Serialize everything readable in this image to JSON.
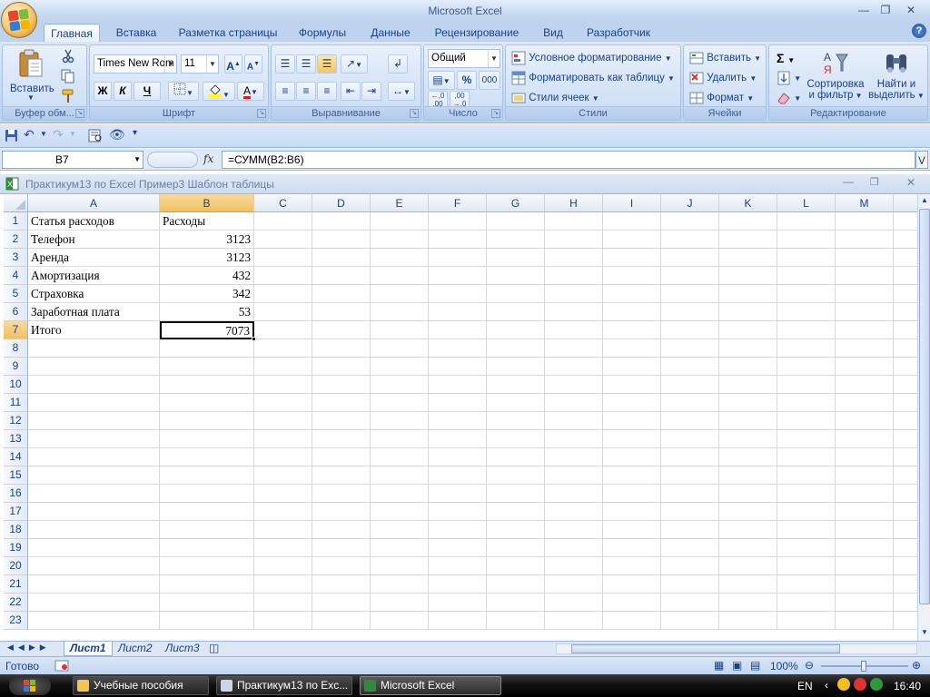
{
  "window": {
    "title": "Microsoft Excel"
  },
  "ribbon_tabs": [
    {
      "label": "Главная",
      "active": true
    },
    {
      "label": "Вставка"
    },
    {
      "label": "Разметка страницы"
    },
    {
      "label": "Формулы"
    },
    {
      "label": "Данные"
    },
    {
      "label": "Рецензирование"
    },
    {
      "label": "Вид"
    },
    {
      "label": "Разработчик"
    }
  ],
  "clipboard": {
    "label": "Буфер обм...",
    "paste_label": "Вставить"
  },
  "font": {
    "label": "Шрифт",
    "name": "Times New Rom",
    "size": "11",
    "bold": "Ж",
    "italic": "К",
    "underline": "Ч"
  },
  "alignment": {
    "label": "Выравнивание"
  },
  "number": {
    "label": "Число",
    "format": "Общий",
    "percent": "%",
    "thousands": "000"
  },
  "styles": {
    "label": "Стили",
    "conditional": "Условное форматирование",
    "format_table": "Форматировать как таблицу",
    "cell_styles": "Стили ячеек"
  },
  "cells": {
    "label": "Ячейки",
    "insert": "Вставить",
    "delete": "Удалить",
    "format": "Формат"
  },
  "editing": {
    "label": "Редактирование",
    "sum": "Σ",
    "sort_1": "Сортировка",
    "sort_2": "и фильтр",
    "find_1": "Найти и",
    "find_2": "выделить"
  },
  "formula_bar": {
    "name_box": "B7",
    "fx": "fx",
    "formula": "=СУММ(B2:B6)"
  },
  "workbook": {
    "title": "Практикум13 по Excel Пример3 Шаблон таблицы"
  },
  "columns": [
    "A",
    "B",
    "C",
    "D",
    "E",
    "F",
    "G",
    "H",
    "I",
    "J",
    "K",
    "L",
    "M"
  ],
  "rows": [
    "1",
    "2",
    "3",
    "4",
    "5",
    "6",
    "7",
    "8",
    "9",
    "10",
    "11",
    "12",
    "13",
    "14",
    "15",
    "16",
    "17",
    "18",
    "19",
    "20",
    "21",
    "22",
    "23"
  ],
  "table": [
    {
      "a": "Статья  расходов",
      "b": "Расходы"
    },
    {
      "a": "Телефон",
      "b": "3123"
    },
    {
      "a": "Аренда",
      "b": "3123"
    },
    {
      "a": "Амортизация",
      "b": "432"
    },
    {
      "a": "Страховка",
      "b": "342"
    },
    {
      "a": "Заработная плата",
      "b": "53"
    },
    {
      "a": "Итого",
      "b": "7073"
    }
  ],
  "sheet_tabs": [
    {
      "label": "Лист1",
      "active": true
    },
    {
      "label": "Лист2"
    },
    {
      "label": "Лист3"
    }
  ],
  "status": {
    "ready": "Готово",
    "zoom": "100%"
  },
  "taskbar": {
    "items": [
      {
        "label": "Учебные пособия"
      },
      {
        "label": "Практикум13 по Exc..."
      },
      {
        "label": "Microsoft Excel",
        "active": true
      }
    ],
    "lang": "EN",
    "time": "16:40"
  },
  "colors": {
    "accent": "#15428b",
    "selection": "#f1c15f",
    "ribbon": "#c4d8f3"
  }
}
